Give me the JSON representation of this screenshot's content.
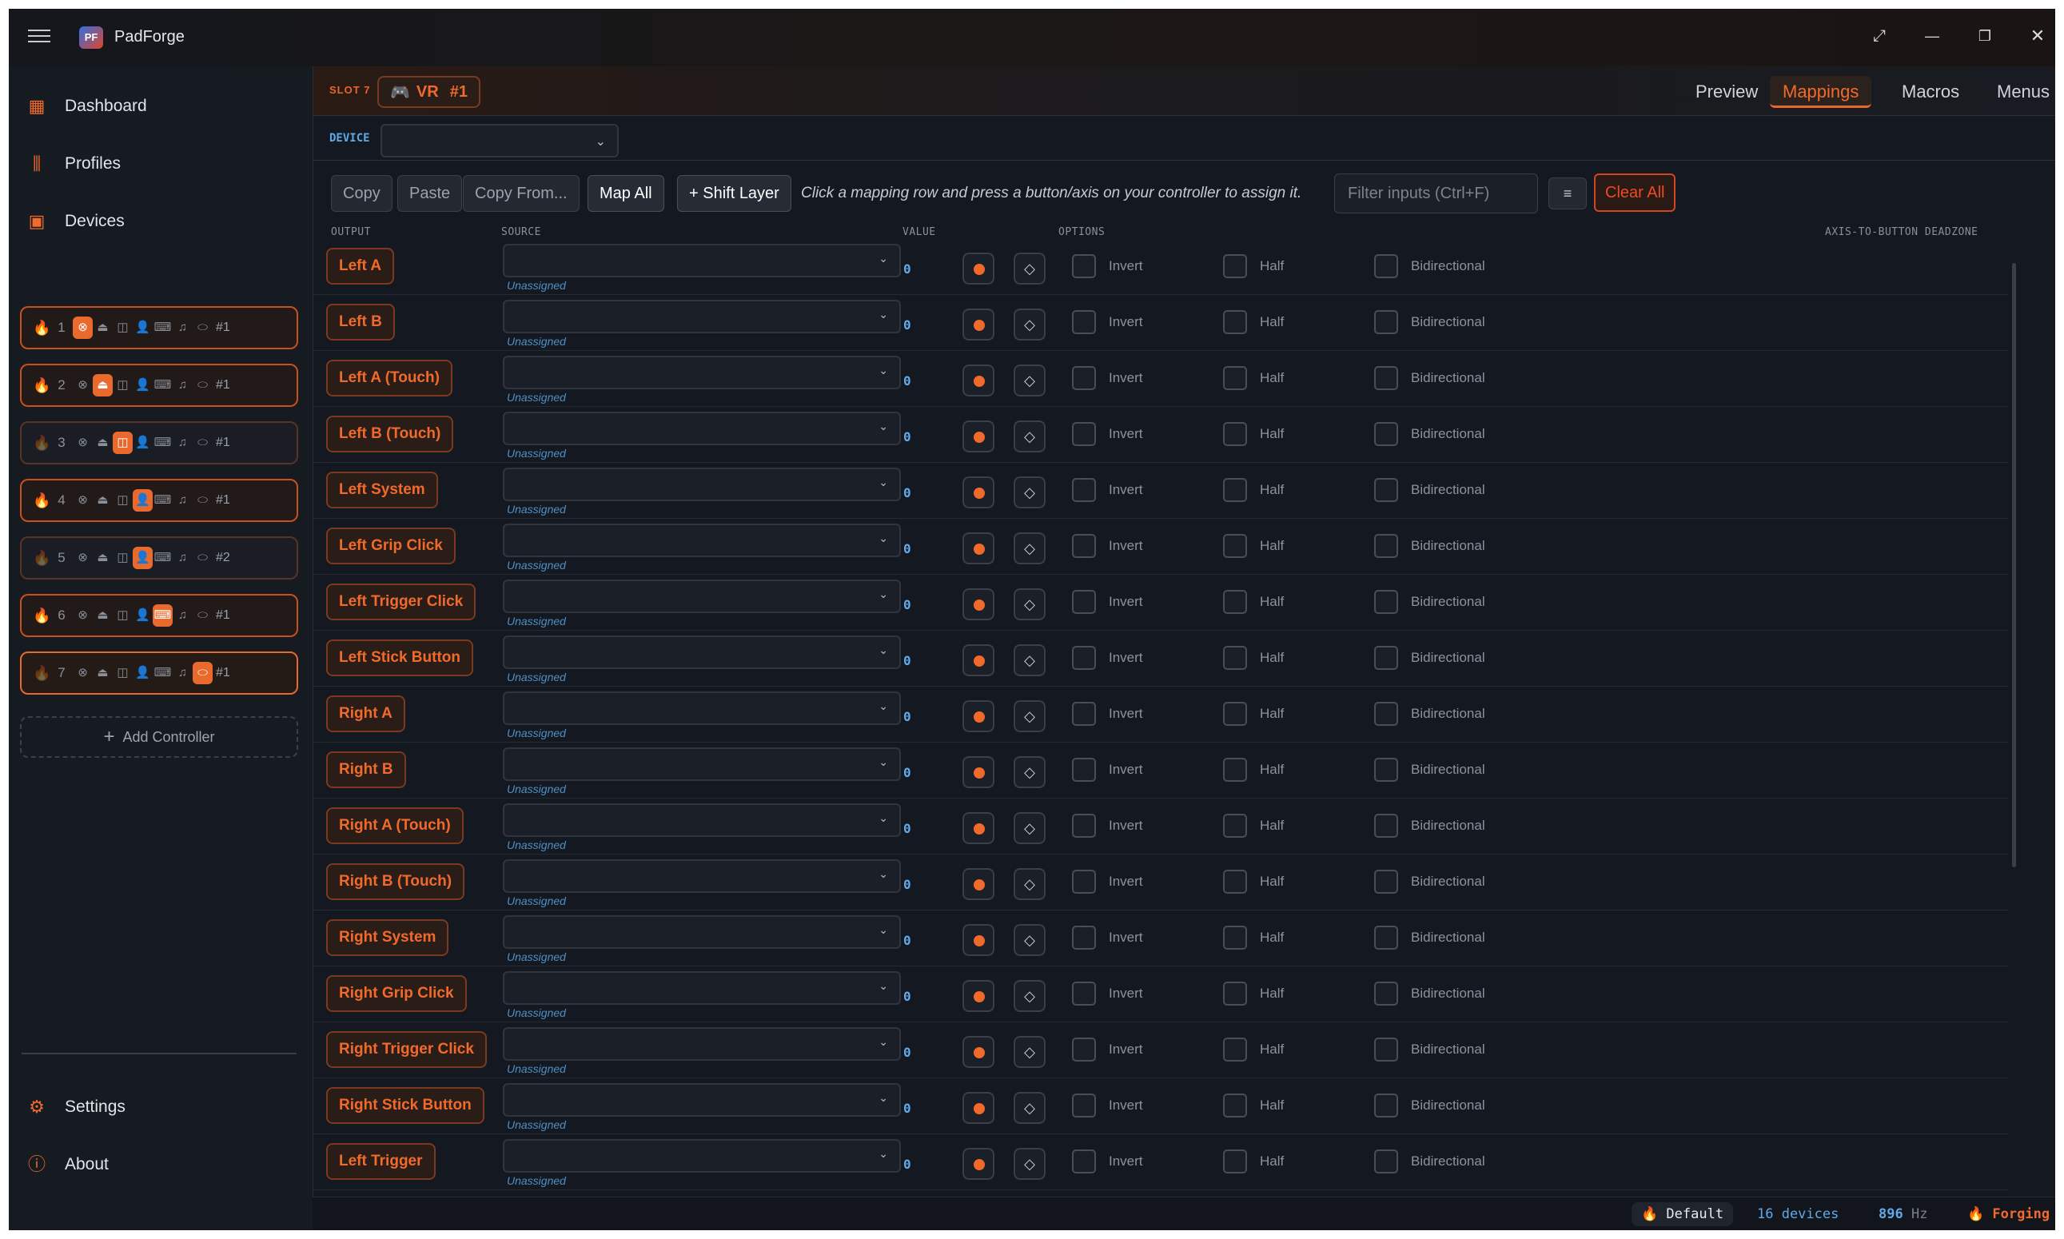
{
  "app": {
    "title": "PadForge",
    "logo_text": "PF"
  },
  "window_controls": {
    "expand": "⤢",
    "minimize": "—",
    "restore": "❐",
    "close": "✕"
  },
  "sidebar": {
    "nav_top": [
      {
        "label": "Dashboard",
        "icon": "dashboard-icon"
      },
      {
        "label": "Profiles",
        "icon": "library-icon"
      },
      {
        "label": "Devices",
        "icon": "devices-icon"
      }
    ],
    "slots": [
      {
        "num": "1",
        "active_icon": 0,
        "index": "#1",
        "flame": "bright"
      },
      {
        "num": "2",
        "active_icon": 1,
        "index": "#1",
        "flame": "bright"
      },
      {
        "num": "3",
        "active_icon": 2,
        "index": "#1",
        "flame": "dim"
      },
      {
        "num": "4",
        "active_icon": 3,
        "index": "#1",
        "flame": "bright"
      },
      {
        "num": "5",
        "active_icon": 3,
        "index": "#2",
        "flame": "dim"
      },
      {
        "num": "6",
        "active_icon": 4,
        "index": "#1",
        "flame": "bright"
      },
      {
        "num": "7",
        "active_icon": 6,
        "index": "#1",
        "flame": "dim"
      }
    ],
    "slot_icons": [
      "xbox-icon",
      "playstation-icon",
      "switch-icon",
      "person-icon",
      "keyboard-icon",
      "midi-icon",
      "vr-icon"
    ],
    "add_controller": "Add Controller",
    "nav_bottom": [
      {
        "label": "Settings",
        "icon": "gear-icon"
      },
      {
        "label": "About",
        "icon": "info-icon"
      }
    ]
  },
  "header": {
    "slot_label": "SLOT 7",
    "slot_chip": "VR",
    "slot_chip_index": "#1",
    "tabs": [
      "Preview",
      "Mappings",
      "Macros",
      "Menus"
    ],
    "active_tab": "Mappings"
  },
  "device": {
    "label": "DEVICE",
    "value": ""
  },
  "toolbar": {
    "copy": "Copy",
    "paste": "Paste",
    "copy_from": "Copy From...",
    "map_all": "Map All",
    "shift_layer": "+ Shift Layer",
    "hint": "Click a mapping row and press a button/axis on your controller to assign it.",
    "filter_placeholder": "Filter inputs (Ctrl+F)",
    "clear_all": "Clear All"
  },
  "columns": {
    "output": "OUTPUT",
    "source": "SOURCE",
    "value": "VALUE",
    "options": "OPTIONS",
    "deadzone": "AXIS-TO-BUTTON DEADZONE"
  },
  "mappings": [
    {
      "output": "Left A",
      "source": "Unassigned",
      "value": "0"
    },
    {
      "output": "Left B",
      "source": "Unassigned",
      "value": "0"
    },
    {
      "output": "Left A (Touch)",
      "source": "Unassigned",
      "value": "0"
    },
    {
      "output": "Left B (Touch)",
      "source": "Unassigned",
      "value": "0"
    },
    {
      "output": "Left System",
      "source": "Unassigned",
      "value": "0"
    },
    {
      "output": "Left Grip Click",
      "source": "Unassigned",
      "value": "0"
    },
    {
      "output": "Left Trigger Click",
      "source": "Unassigned",
      "value": "0"
    },
    {
      "output": "Left Stick Button",
      "source": "Unassigned",
      "value": "0"
    },
    {
      "output": "Right A",
      "source": "Unassigned",
      "value": "0"
    },
    {
      "output": "Right B",
      "source": "Unassigned",
      "value": "0"
    },
    {
      "output": "Right A (Touch)",
      "source": "Unassigned",
      "value": "0"
    },
    {
      "output": "Right B (Touch)",
      "source": "Unassigned",
      "value": "0"
    },
    {
      "output": "Right System",
      "source": "Unassigned",
      "value": "0"
    },
    {
      "output": "Right Grip Click",
      "source": "Unassigned",
      "value": "0"
    },
    {
      "output": "Right Trigger Click",
      "source": "Unassigned",
      "value": "0"
    },
    {
      "output": "Right Stick Button",
      "source": "Unassigned",
      "value": "0"
    },
    {
      "output": "Left Trigger",
      "source": "Unassigned",
      "value": "0"
    }
  ],
  "options": {
    "invert": "Invert",
    "half": "Half",
    "bidirectional": "Bidirectional"
  },
  "status": {
    "profile": "Default",
    "devices": "16 devices",
    "rate_value": "896",
    "rate_unit": "Hz",
    "engine": "Forging"
  },
  "colors": {
    "accent": "#f06a2c",
    "value_blue": "#62a9e8",
    "clear_red": "#ef4a22"
  }
}
